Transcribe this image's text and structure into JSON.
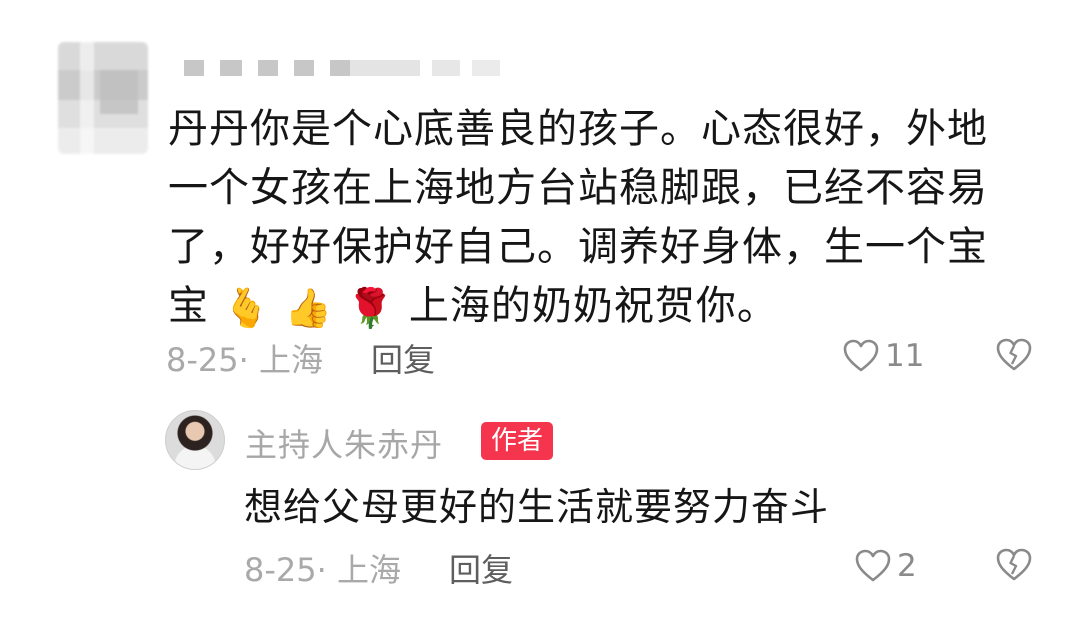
{
  "comment": {
    "text": "丹丹你是个心底善良的孩子。心态很好，外地一个女孩在上海地方台站稳脚跟，已经不容易了，好好保护好自己。调养好身体，生一个宝宝",
    "emojis": [
      "🫰",
      "👍",
      "🌹"
    ],
    "text_after_emoji": "上海的奶奶祝贺你。",
    "date_location": "8-25· 上海",
    "reply_label": "回复",
    "likes": "11",
    "icons": {
      "like": "heart-outline-icon",
      "dislike": "broken-heart-icon"
    }
  },
  "reply": {
    "author": "主持人朱赤丹",
    "badge": "作者",
    "text": "想给父母更好的生活就要努力奋斗",
    "date_location": "8-25· 上海",
    "reply_label": "回复",
    "likes": "2",
    "icons": {
      "like": "heart-outline-icon",
      "dislike": "broken-heart-icon"
    }
  },
  "colors": {
    "badge": "#f5354e",
    "meta": "#a9a9a9",
    "text": "#161616"
  }
}
